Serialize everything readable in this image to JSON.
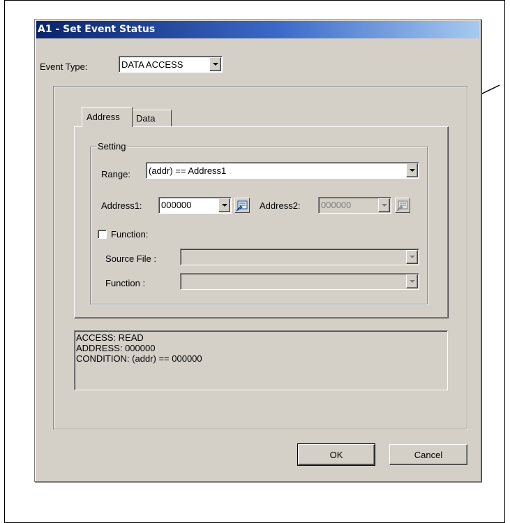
{
  "dialog": {
    "title": "A1 - Set Event Status",
    "event_type_label": "Event Type:",
    "event_type_value": "DATA ACCESS",
    "tabs": [
      {
        "label": "Address",
        "selected": true
      },
      {
        "label": "Data",
        "selected": false
      }
    ],
    "setting": {
      "group_label": "Setting",
      "range_label": "Range:",
      "range_value": "(addr) == Address1",
      "address1_label": "Address1:",
      "address1_value": "000000",
      "address2_label": "Address2:",
      "address2_value": "000000",
      "function_checkbox_label": "Function:",
      "function_checked": false,
      "source_file_label": "Source File :",
      "function_label": "Function :"
    },
    "summary_lines": [
      "ACCESS: READ",
      "ADDRESS: 000000",
      "CONDITION: (addr) == 000000"
    ],
    "ok_label": "OK",
    "cancel_label": "Cancel"
  },
  "icons": {
    "address_picker": "address-picker-icon",
    "dropdown": "chevron-down-icon",
    "annotation": "annotation-arrow"
  }
}
